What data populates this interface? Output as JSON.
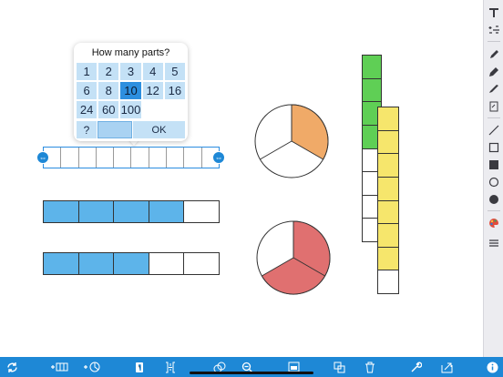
{
  "popover": {
    "title": "How many parts?",
    "numbers": [
      "1",
      "2",
      "3",
      "4",
      "5",
      "6",
      "8",
      "10",
      "12",
      "16",
      "24",
      "60",
      "100"
    ],
    "selected": "10",
    "custom_label": "?",
    "custom_value": "",
    "ok_label": "OK"
  },
  "colors": {
    "bar_fill": "#5db4ea",
    "circle_orange": "#f0aa68",
    "circle_red": "#e07070",
    "stack_green": "#5fcf55",
    "stack_yellow": "#f6e66c",
    "toolbar_blue": "#1e88d6"
  },
  "bars": [
    {
      "name": "editing-bar",
      "parts": 10,
      "filled": 0
    },
    {
      "name": "bar-4-of-5",
      "parts": 5,
      "filled": 4
    },
    {
      "name": "bar-3-of-5",
      "parts": 5,
      "filled": 3
    }
  ],
  "circles": [
    {
      "name": "circle-thirds-orange",
      "parts": 3,
      "filled": 1
    },
    {
      "name": "circle-thirds-red",
      "parts": 3,
      "filled": 2
    }
  ],
  "stacks": [
    {
      "name": "green-stack",
      "parts": 8,
      "filled": 4
    },
    {
      "name": "yellow-stack",
      "parts": 8,
      "filled": 7
    }
  ],
  "right_toolbar": [
    "text-icon",
    "fraction-format-icon",
    "pen-icon",
    "marker-icon",
    "highlighter-icon",
    "note-icon",
    "line-icon",
    "rectangle-outline-icon",
    "rectangle-filled-icon",
    "circle-outline-icon",
    "circle-filled-icon",
    "color-palette-icon",
    "menu-icon"
  ],
  "bottom_toolbar": [
    "refresh-icon",
    "add-bar-icon",
    "add-circle-icon",
    "label-icon",
    "fraction-label-icon",
    "group-icon",
    "zoom-out-icon",
    "image-icon",
    "duplicate-icon",
    "trash-icon",
    "wrench-icon",
    "share-icon",
    "info-icon"
  ]
}
